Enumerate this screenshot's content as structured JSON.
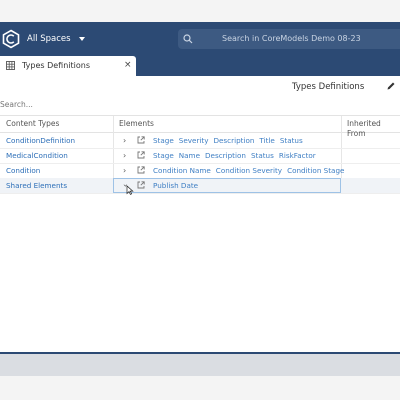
{
  "header": {
    "spaces_label": "All Spaces",
    "search_placeholder": "Search in CoreModels Demo 08-23"
  },
  "tab": {
    "label": "Types Definitions",
    "close": "×"
  },
  "page": {
    "title": "Types Definitions",
    "filter_placeholder": "Search..."
  },
  "table": {
    "headers": [
      "Content Types",
      "Elements",
      "Inherited From"
    ],
    "rows": [
      {
        "type": "ConditionDefinition",
        "elements": [
          "Stage",
          "Severity",
          "Description",
          "Title",
          "Status"
        ]
      },
      {
        "type": "MedicalCondition",
        "elements": [
          "Stage",
          "Name",
          "Description",
          "Status",
          "RiskFactor"
        ]
      },
      {
        "type": "Condition",
        "elements": [
          "Condition Name",
          "Condition Severity",
          "Condition Stage"
        ]
      },
      {
        "type": "Shared Elements",
        "elements": [
          "Publish Date"
        ]
      }
    ]
  },
  "colors": {
    "header_bg": "#2c4a74",
    "link": "#2d6fb8",
    "selected_outline": "#9ec2e6"
  },
  "icons": [
    "coremodels-logo-icon",
    "caret-down-icon",
    "search-icon",
    "grid-icon",
    "close-icon",
    "pencil-icon",
    "chevron-right-icon",
    "external-link-icon",
    "cursor-icon"
  ]
}
